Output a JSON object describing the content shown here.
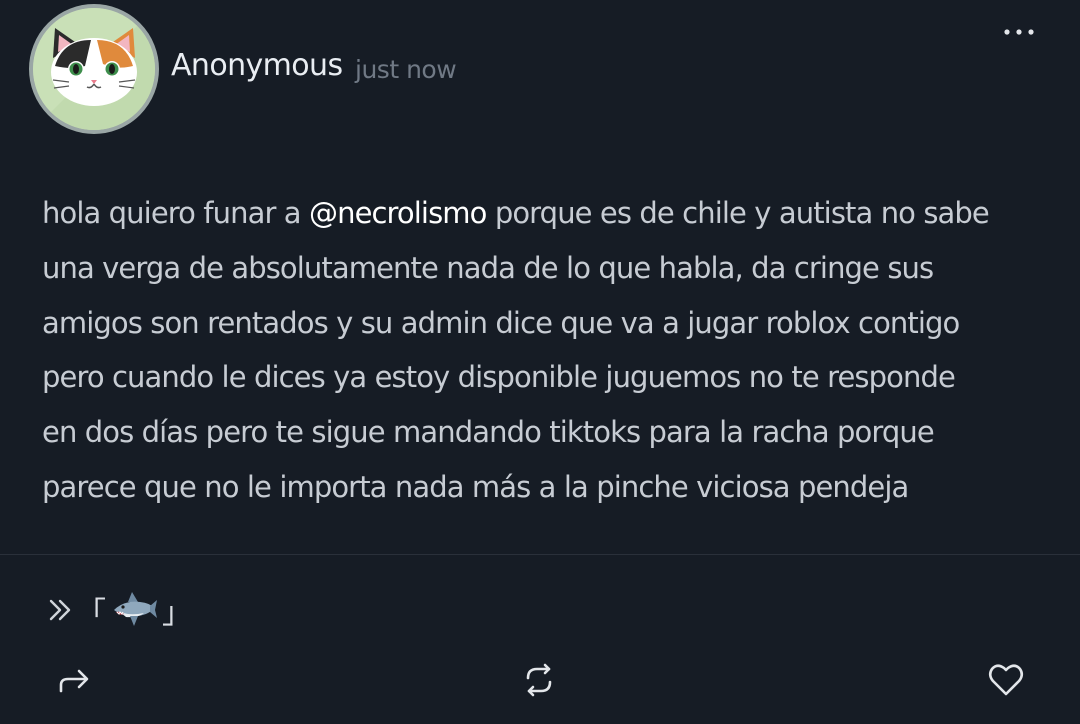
{
  "post": {
    "author": "Anonymous",
    "timestamp": "just now",
    "avatar_icon": "calico-cat-avatar",
    "body": {
      "l1_before": "hola quiero funar a ",
      "mention": "@necrolismo",
      "l1_after": " porque es de chile y autista no sabe",
      "l2": "una verga de absolutamente nada de lo que habla, da cringe sus",
      "l3": "amigos son rentados y su admin dice que va a jugar roblox contigo",
      "l4": "pero cuando le dices ya estoy disponible juguemos no te responde",
      "l5": "en dos días pero te sigue mandando tiktoks para la racha porque",
      "l6": "parece que no le importa nada más a la pinche viciosa pendeja"
    },
    "topic": {
      "open_bracket": "「",
      "close_bracket": "」",
      "icon": "shark-icon"
    }
  },
  "actions": [
    "share-icon",
    "repost-icon",
    "heart-icon"
  ],
  "colors": {
    "background": "#161c25",
    "text": "#c7ccd3",
    "mention": "#ffffff",
    "muted": "#707985",
    "divider": "#2a303a"
  }
}
